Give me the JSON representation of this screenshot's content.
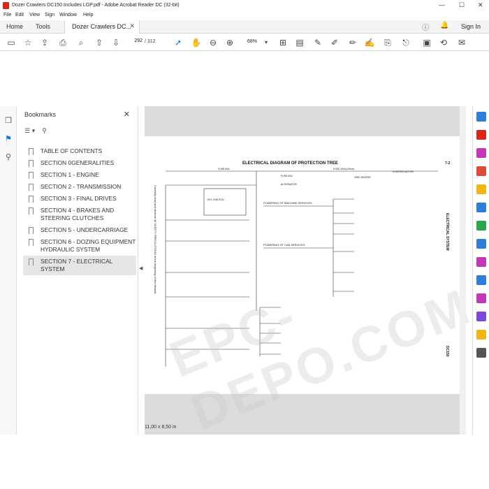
{
  "window": {
    "title": "Dozer Crawlers DC150 Includes LGP.pdf - Adobe Acrobat Reader DC (32-bit)",
    "minimize": "—",
    "maximize": "☐",
    "close": "✕"
  },
  "menu": [
    "File",
    "Edit",
    "View",
    "Sign",
    "Window",
    "Help"
  ],
  "tabs": {
    "home": "Home",
    "tools": "Tools",
    "document": "Dozer Crawlers DC...",
    "sign_in": "Sign In"
  },
  "toolbar": {
    "current_page": "292",
    "total_pages": "/ 312",
    "zoom": "68%"
  },
  "bookmarks": {
    "header": "Bookmarks",
    "items": [
      "TABLE OF CONTENTS",
      "SECTION 0GENERALITIES",
      "SECTION 1 - ENGINE",
      "SECTION 2 - TRANSMISSION",
      "SECTION 3 - FINAL DRIVES",
      "SECTION 4 - BRAKES AND STEERING CLUTCHES",
      "SECTION 5 - UNDERCARRIAGE",
      "SECTION 6 - DOZING EQUIPMENT HYDRAULIC SYSTEM",
      "SECTION 7 - ELECTRICAL SYSTEM"
    ]
  },
  "diagram": {
    "title": "ELECTRICAL DIAGRAM OF PROTECTION TREE",
    "page_no": "7-2",
    "side_label": "ELECTRICAL SYSTEM",
    "model": "DC150",
    "left_note": "Carefully read and observe all SAFETY PRECAUTIONS at the beginning of this Manual",
    "labels": {
      "fuse_50a": "FUSE 50A",
      "fuse_60a": "FUSE 60A",
      "fuse_200a": "FUSE 200A (Ohne)",
      "starter_motor": "STARTER MOTOR",
      "alternator": "ALTERNATOR",
      "grid_heater": "GRID HEATER",
      "key_ignition": "KEY IGNITION",
      "powering_machine": "POWERING OF MACHINE SERVICES",
      "powering_cab": "POWERING OF CAB SERVICES"
    }
  },
  "status": {
    "page_size": "11,00 x 8,50 in"
  },
  "watermark": "EPC-DEPO.COM"
}
